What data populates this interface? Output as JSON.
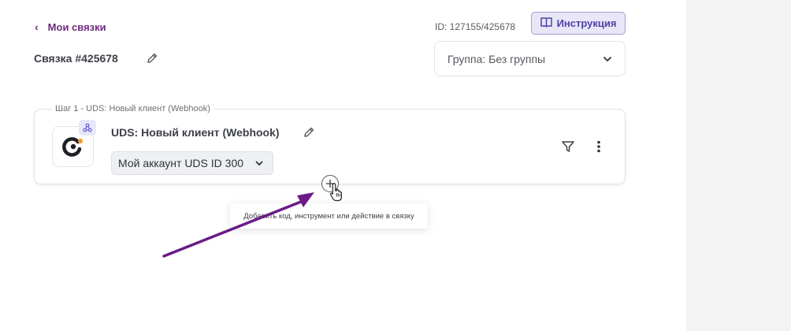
{
  "header": {
    "back_label": "Мои связки",
    "id_text": "ID: 127155/425678",
    "instruction_label": "Инструкция"
  },
  "bundle": {
    "title": "Связка #425678",
    "group_select_value": "Группа: Без группы"
  },
  "step": {
    "legend": "Шаг 1 - UDS: Новый клиент (Webhook)",
    "name": "UDS: Новый клиент (Webhook)",
    "account_value": "Мой аккаунт UDS ID 300"
  },
  "tooltip": {
    "text": "Добавить код, инструмент или действие в связку"
  },
  "colors": {
    "brand_purple": "#6e2a7f",
    "accent_indigo": "#4b44a6",
    "uds_orange": "#f39a2b",
    "annotation_arrow": "#6a1b86"
  },
  "icons": {
    "back": "chevron-left-icon",
    "instruction": "book-icon",
    "edit": "pencil-icon",
    "dropdown": "chevron-down-icon",
    "webhook": "webhook-icon",
    "filter": "filter-icon",
    "more": "kebab-menu-icon",
    "add": "plus-circle-icon",
    "cursor": "hand-pointer-icon"
  }
}
